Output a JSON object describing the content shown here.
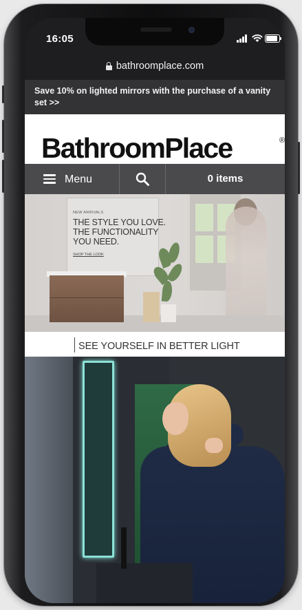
{
  "status_bar": {
    "time": "16:05",
    "icons": [
      "cellular-signal-icon",
      "wifi-icon",
      "battery-icon"
    ]
  },
  "browser": {
    "url": "bathroomplace.com"
  },
  "promo_banner": {
    "text": "Save 10% on lighted mirrors with the purchase of a vanity set >>"
  },
  "header": {
    "logo_text": "BathroomPlace",
    "logo_mark": "®"
  },
  "nav": {
    "menu_label": "Menu",
    "search_icon": "search-icon",
    "cart_label": "0 items"
  },
  "hero": {
    "eyebrow": "NEW ARRIVALS",
    "headline_line1": "THE STYLE YOU LOVE.",
    "headline_line2": "THE FUNCTIONALITY",
    "headline_line3": "YOU NEED.",
    "link": "SHOP THE LOOK"
  },
  "section": {
    "title": "SEE YOURSELF IN BETTER LIGHT"
  },
  "colors": {
    "nav_bg": "#4a4a4c",
    "promo_bg": "#333335",
    "led_accent": "#8be2d6"
  }
}
